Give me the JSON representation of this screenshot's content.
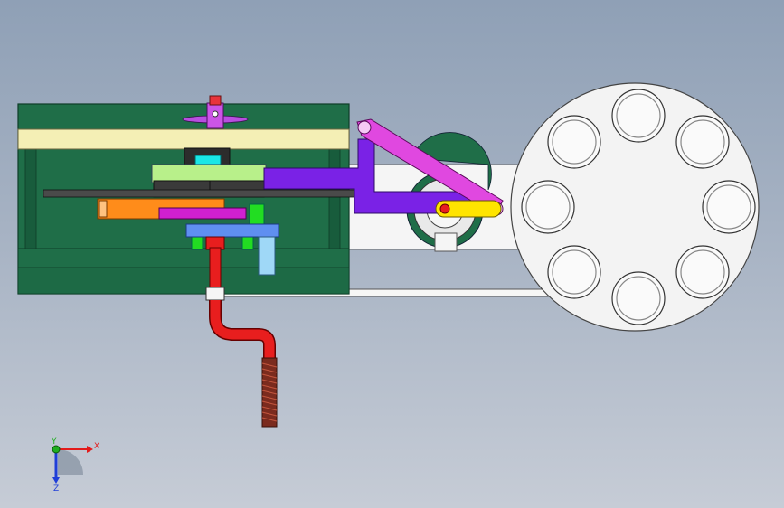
{
  "viewport": {
    "background": {
      "top": "#8fa0b6",
      "bottom": "#c6ccd6"
    }
  },
  "colors": {
    "frame_green": "#1f6e48",
    "frame_green_dark": "#14523a",
    "plate_cream": "#f4efb5",
    "wheel_white": "#f2f2f2",
    "link_magenta": "#e048e0",
    "slide_purple": "#7a22e6",
    "die_lightgreen": "#b8f08a",
    "pipe_red": "#e81e1e",
    "spring_brown": "#7b2b1e",
    "orange_block": "#ff8c1a",
    "blue_block": "#5f8ff0",
    "yellow_arm": "#ffe400",
    "cyan_block": "#19e6e6"
  },
  "triad": {
    "x_label": "X",
    "y_label": "Y",
    "z_label": "Z",
    "x_color": "#e31b1b",
    "y_color": "#1fae1f",
    "z_color": "#1f3ed8"
  }
}
